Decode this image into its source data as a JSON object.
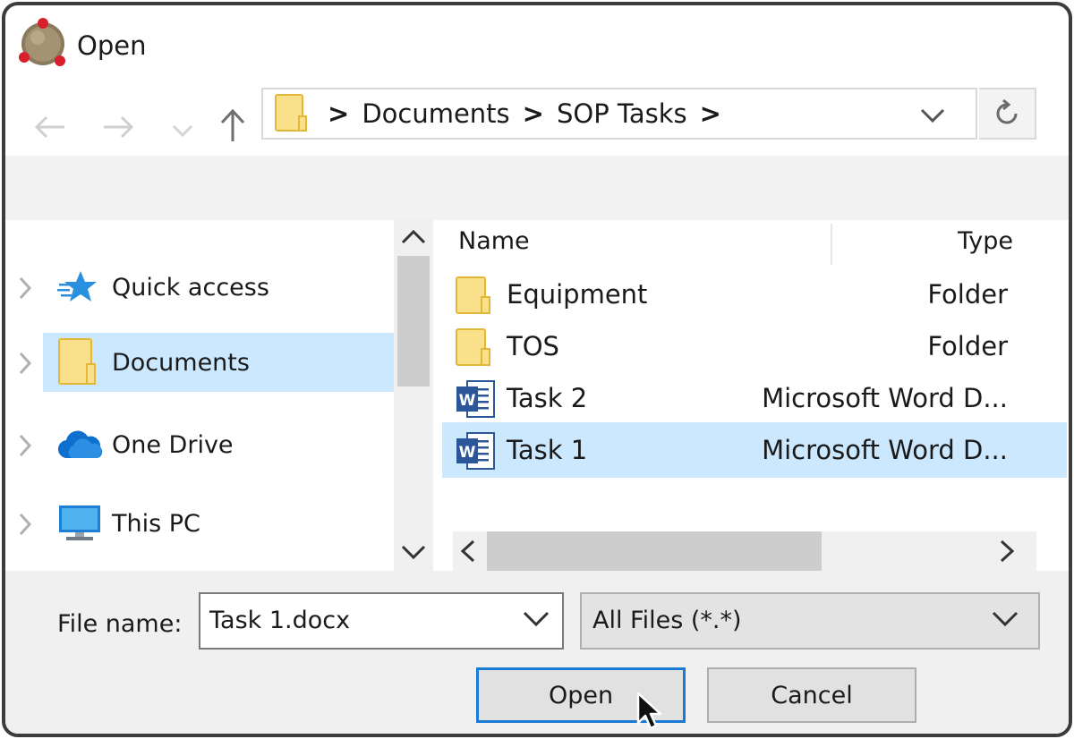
{
  "window": {
    "title": "Open",
    "app_icon": "app-logo-icon"
  },
  "nav_buttons": {
    "back_icon": "arrow-left-icon",
    "forward_icon": "arrow-right-icon",
    "recent_icon": "chevron-down-icon",
    "up_icon": "arrow-up-icon"
  },
  "address_bar": {
    "folder_icon": "folder-icon",
    "breadcrumbs": [
      ">",
      "Documents",
      ">",
      "SOP Tasks",
      ">"
    ],
    "dropdown_icon": "chevron-down-icon",
    "refresh_icon": "refresh-icon"
  },
  "nav_pane": {
    "items": [
      {
        "label": "Quick access",
        "icon": "star-icon",
        "selected": false
      },
      {
        "label": "Documents",
        "icon": "folder-icon",
        "selected": true
      },
      {
        "label": "One Drive",
        "icon": "cloud-icon",
        "selected": false
      },
      {
        "label": "This PC",
        "icon": "monitor-icon",
        "selected": false
      }
    ]
  },
  "file_list": {
    "columns": [
      "Name",
      "Type"
    ],
    "rows": [
      {
        "name": "Equipment",
        "type": "Folder",
        "icon": "folder-icon",
        "selected": false
      },
      {
        "name": "TOS",
        "type": "Folder",
        "icon": "folder-icon",
        "selected": false
      },
      {
        "name": "Task 2",
        "type": "Microsoft Word D...",
        "icon": "word-doc-icon",
        "selected": false
      },
      {
        "name": "Task 1",
        "type": "Microsoft Word D...",
        "icon": "word-doc-icon",
        "selected": true
      }
    ]
  },
  "bottom": {
    "file_name_label": "File name:",
    "file_name_value": "Task 1.docx",
    "file_type_value": "All Files (*.*)",
    "open_label": "Open",
    "cancel_label": "Cancel"
  },
  "colors": {
    "selection": "#cce8ff",
    "accent": "#1979d3",
    "folder": "#fbe08c"
  }
}
